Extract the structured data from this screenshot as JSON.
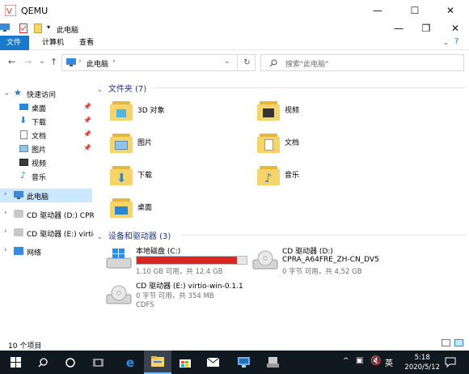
{
  "qemu": {
    "title": "QEMU",
    "minimize": "—",
    "maximize": "☐",
    "close": "✕"
  },
  "explorer": {
    "title": "此电脑",
    "minimize": "—",
    "restore": "❐",
    "close": "✕"
  },
  "ribbon": {
    "tabs": [
      "文件",
      "计算机",
      "查看"
    ]
  },
  "nav": {
    "back": "←",
    "forward": "→",
    "recent": "⌄",
    "up": "↑",
    "refresh": "↻"
  },
  "address": {
    "path": "此电脑",
    "chevron": "›",
    "dropdown": "⌄"
  },
  "search": {
    "placeholder": "搜索\"此电脑\""
  },
  "sidebar": {
    "quick_access": "快速访问",
    "items": [
      {
        "label": "桌面",
        "pinned": true
      },
      {
        "label": "下载",
        "pinned": true
      },
      {
        "label": "文档",
        "pinned": true
      },
      {
        "label": "图片",
        "pinned": true
      },
      {
        "label": "视频",
        "pinned": false
      },
      {
        "label": "音乐",
        "pinned": false
      }
    ],
    "this_pc": "此电脑",
    "cd_d": "CD 驱动器 (D:) CPRA",
    "cd_e": "CD 驱动器 (E:) virtio",
    "network": "网络"
  },
  "content": {
    "folders_header": "文件夹 (7)",
    "folders": [
      "3D 对象",
      "视频",
      "图片",
      "文档",
      "下载",
      "音乐",
      "桌面"
    ],
    "drives_header": "设备和驱动器 (3)",
    "drives": [
      {
        "name": "本地磁盘 (C:)",
        "used_fraction": 0.91,
        "info": "1.10 GB 可用，共 12.4 GB"
      },
      {
        "name": "CD 驱动器 (D:)",
        "label": "CPRA_A64FRE_ZH-CN_DV5",
        "info": "0 字节 可用，共 4.52 GB"
      },
      {
        "name": "CD 驱动器 (E:) virtio-win-0.1.1",
        "info": "0 字节 可用，共 354 MB",
        "fs": "CDFS"
      }
    ]
  },
  "status": {
    "count": "10 个项目"
  },
  "taskbar": {
    "time": "5:18",
    "date": "2020/5/12",
    "ime": "英"
  },
  "colors": {
    "accent": "#1979ca",
    "selected": "#cce8ff",
    "drive_bar": "#da2626",
    "taskbar": "#101820"
  }
}
